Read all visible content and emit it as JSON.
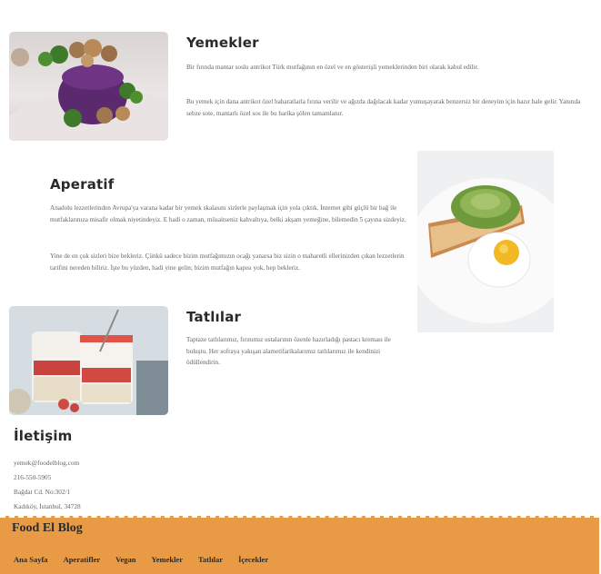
{
  "sections": {
    "yemekler": {
      "title": "Yemekler",
      "p1": "Bir fırında mantar soslu antrikot Türk mutfağının en özel ve en gösterişli yemeklerinden biri olarak kabul edilir.",
      "p2": "Bu yemek için dana antrikot özel baharatlarla fırına verilir ve ağızda dağılacak kadar yumuşayarak benzersiz bir deneyim için hazır hale gelir. Yanında sebze sote, mantarlı özel sos ile bu harika şölen tamamlanır."
    },
    "aperatif": {
      "title": "Aperatif",
      "p1": "Anadolu lezzetlerinden Avrupa'ya varana kadar bir yemek skalasını sizlerle paylaşmak için yola çıktık. İnternet gibi güçlü bir bağ ile mutfaklarınıza misafir olmak niyetindeyiz. E hadi o zaman, müsaitseniz kahvaltıya, belki akşam yemeğine, bilemedin 5 çayına sizdeyiz.",
      "p2": "Yine de en çok sizleri bize bekleriz. Çünkü sadece bizim mutfağımızın ocağı yanarsa biz sizin o maharetli ellerinizden çıkan lezzetlerin tarifini nereden biliriz. İşte bu yüzden, hadi yine gelin; bizim mutfağın kapısı yok, hep bekleriz."
    },
    "tatlilar": {
      "title": "Tatlılar",
      "p1": "Taptaze tatlılarımız, fırınımız ustalarının özenle hazırladığı pastacı kreması ile buluştu. Her sofraya yakışan alametifarikalarımız tatlılarımız ile kendinizi ödüllendirin."
    }
  },
  "contact": {
    "title": "İletişim",
    "email": "yemek@foodelblog.com",
    "phone": "216-550-5905",
    "address1": "Bağdat Cd. No:302/1",
    "address2": "Kadıköy, İstanbul, 34728"
  },
  "footer": {
    "brand": "Food El Blog",
    "nav": [
      "Ana Sayfa",
      "Aperatifler",
      "Vegan",
      "Yemekler",
      "Tatlılar",
      "İçecekler"
    ]
  },
  "colors": {
    "footer_bg": "#e99a45",
    "heading": "#2a2a2a",
    "body_text": "#666666"
  }
}
